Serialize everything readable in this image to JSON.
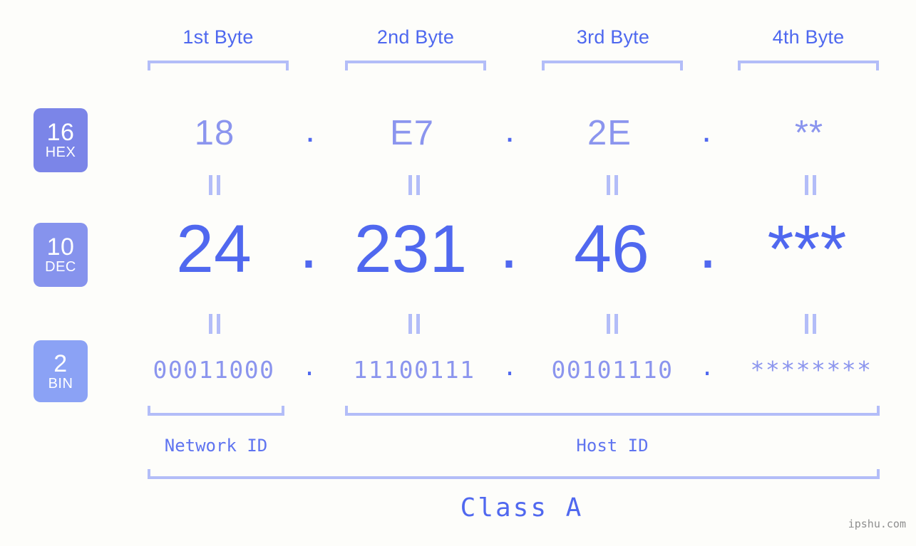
{
  "page": {
    "background": "#fdfdfa",
    "watermark": "ipshu.com"
  },
  "colors": {
    "accent_strong": "#5068ef",
    "accent_mid": "#8b95ee",
    "accent_light": "#b3bdf8",
    "badge_hex": "#7b85e8",
    "badge_dec": "#8693ed",
    "badge_bin": "#8ba2f5",
    "header_text": "#4e68ef"
  },
  "byte_headers": [
    {
      "label": "1st Byte"
    },
    {
      "label": "2nd Byte"
    },
    {
      "label": "3rd Byte"
    },
    {
      "label": "4th Byte"
    }
  ],
  "bases": [
    {
      "number": "16",
      "name": "HEX"
    },
    {
      "number": "10",
      "name": "DEC"
    },
    {
      "number": "2",
      "name": "BIN"
    }
  ],
  "rows": {
    "hex": {
      "base_number": "16",
      "base_name": "HEX",
      "values": [
        "18",
        "E7",
        "2E",
        "**"
      ],
      "separator": "."
    },
    "dec": {
      "base_number": "10",
      "base_name": "DEC",
      "values": [
        "24",
        "231",
        "46",
        "***"
      ],
      "separator": "."
    },
    "bin": {
      "base_number": "2",
      "base_name": "BIN",
      "values": [
        "00011000",
        "11100111",
        "00101110",
        "********"
      ],
      "separator": "."
    }
  },
  "sections": {
    "network_id": "Network ID",
    "host_id": "Host ID",
    "class": "Class A"
  }
}
